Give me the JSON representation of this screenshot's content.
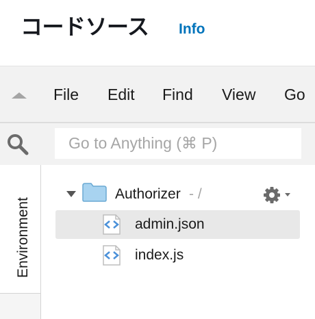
{
  "header": {
    "title": "コードソース",
    "info_link": "Info"
  },
  "menubar": {
    "items": [
      "File",
      "Edit",
      "Find",
      "View",
      "Go"
    ]
  },
  "search": {
    "placeholder": "Go to Anything (⌘ P)"
  },
  "sidebar": {
    "environment_tab": "Environment"
  },
  "tree": {
    "folder": {
      "name": "Authorizer",
      "path": "- /",
      "expanded": true
    },
    "files": [
      {
        "name": "admin.json",
        "selected": true,
        "icon": "code-file-icon"
      },
      {
        "name": "index.js",
        "selected": false,
        "icon": "code-file-icon"
      }
    ]
  },
  "colors": {
    "accent_link": "#0073bb",
    "menubar_bg": "#f2f2f2",
    "selected_row_bg": "#e8e8e8",
    "folder_fill": "#a8d3f0"
  }
}
